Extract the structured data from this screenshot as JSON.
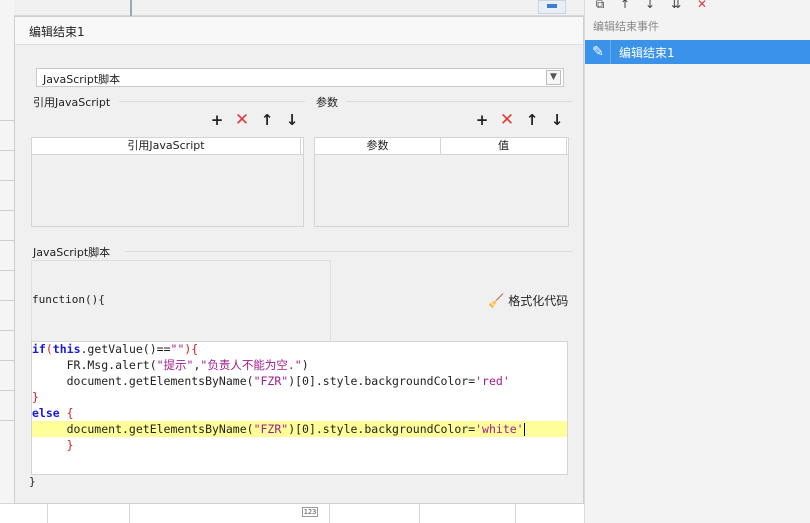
{
  "dialog": {
    "title": "编辑结束1",
    "script_type": "JavaScript脚本",
    "ref_js": {
      "label": "引用JavaScript",
      "column": "引用JavaScript"
    },
    "params": {
      "label": "参数",
      "columns": [
        "参数",
        "值"
      ]
    },
    "script": {
      "label": "JavaScript脚本",
      "fn_open": "function(){",
      "format_label": "格式化代码",
      "fn_close": "}"
    },
    "code": {
      "l1_kw": "if",
      "l1_p1": "(",
      "l1_this": "this",
      "l1_p2": ".getValue()==",
      "l1_str": "\"\"",
      "l1_p3": "){",
      "l2_a": "     FR.Msg.alert(",
      "l2_s1": "\"提示\"",
      "l2_c": ",",
      "l2_s2": "\"负责人不能为空.\"",
      "l2_e": ")",
      "l3_a": "     document.getElementsByName(",
      "l3_s": "\"FZR\"",
      "l3_b": ")[0].style.backgroundColor=",
      "l3_v": "'red'",
      "l4": "}",
      "l5_kw": "else",
      "l5_b": " {",
      "l6_a": "     document.getElementsByName(",
      "l6_s": "\"FZR\"",
      "l6_b": ")[0].style.backgroundColor=",
      "l6_v": "'white'",
      "l7": "     }"
    }
  },
  "right_panel": {
    "title": "编辑结束事件",
    "items": [
      {
        "label": "编辑结束1"
      }
    ]
  },
  "sheet": {
    "badge": "123"
  },
  "icons": {
    "add": "plus-icon",
    "delete": "delete-x-icon",
    "up": "arrow-up-icon",
    "down": "arrow-down-icon",
    "edit": "pencil-icon",
    "format": "broom-icon"
  },
  "colors": {
    "selection": "#3a93e8",
    "delete": "#e23b3b",
    "keyword": "#1a1adb",
    "string": "#a21a8f",
    "line_highlight": "#ffff99"
  }
}
